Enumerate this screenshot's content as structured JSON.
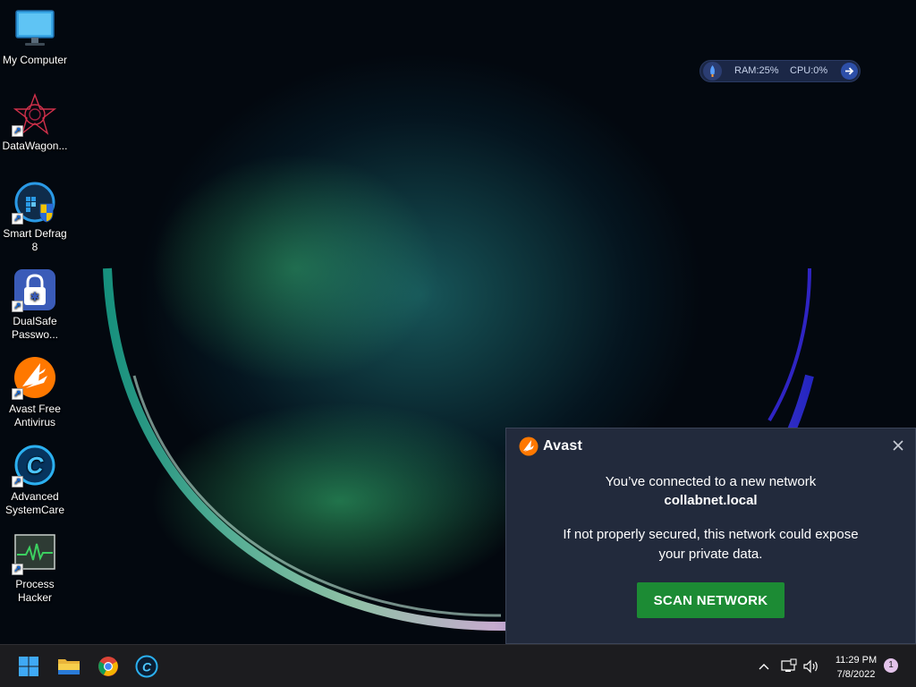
{
  "desktop": {
    "icons": [
      {
        "label": "My Computer",
        "icon": "monitor-icon",
        "shortcut": false
      },
      {
        "label": "DataWagon...",
        "icon": "datawagon-icon",
        "shortcut": true
      },
      {
        "label": "Smart Defrag 8",
        "icon": "smart-defrag-icon",
        "shortcut": true
      },
      {
        "label": "DualSafe Passwo...",
        "icon": "dualsafe-icon",
        "shortcut": true
      },
      {
        "label": "Avast Free Antivirus",
        "icon": "avast-icon",
        "shortcut": true
      },
      {
        "label": "Advanced SystemCare",
        "icon": "advanced-systemcare-icon",
        "shortcut": true
      },
      {
        "label": "Process Hacker",
        "icon": "process-hacker-icon",
        "shortcut": true
      }
    ]
  },
  "perf_widget": {
    "ram": "RAM:25%",
    "cpu": "CPU:0%"
  },
  "avast_popup": {
    "brand": "Avast",
    "line1": "You’ve connected to a new network",
    "network": "collabnet.local",
    "warning_line1": "If not properly secured, this network could expose",
    "warning_line2": "your private data.",
    "button": "SCAN NETWORK",
    "brand_color": "#ff7800",
    "button_color": "#1c8b34"
  },
  "taskbar": {
    "pinned": [
      "start-icon",
      "file-explorer-icon",
      "chrome-icon",
      "advanced-systemcare-icon"
    ],
    "tray": [
      "chevron-up-icon",
      "network-icon",
      "volume-icon"
    ],
    "time": "11:29 PM",
    "date": "7/8/2022",
    "notifications": "1"
  }
}
